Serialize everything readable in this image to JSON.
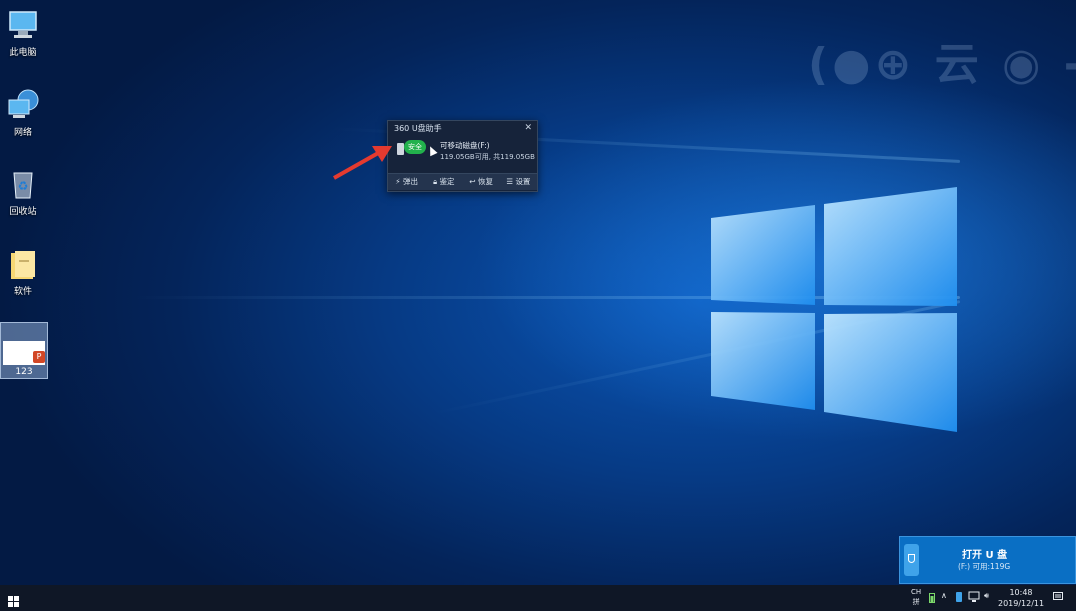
{
  "desktop": {
    "icons": [
      {
        "label": "此电脑",
        "icon": "computer-icon"
      },
      {
        "label": "网络",
        "icon": "network-icon"
      },
      {
        "label": "回收站",
        "icon": "recycle-bin-icon"
      },
      {
        "label": "软件",
        "icon": "folder-icon"
      },
      {
        "label": "123",
        "icon": "powerpoint-file-icon"
      }
    ],
    "watermark": "(●⊕ 云 ◉ -"
  },
  "u_disk_widget": {
    "title": "360 U盘助手",
    "close_glyph": "✕",
    "safe_badge": "安全",
    "drive_name": "可移动磁盘(F:)",
    "drive_space": "119.05GB可用, 共119.05GB",
    "tools": [
      {
        "label": "弹出",
        "icon": "eject-icon"
      },
      {
        "label": "鉴定",
        "icon": "lock-icon"
      },
      {
        "label": "恢复",
        "icon": "restore-icon"
      },
      {
        "label": "设置",
        "icon": "settings-list-icon"
      }
    ]
  },
  "usb_popup": {
    "title": "打开 U 盘",
    "subtitle": "(F:)  可用:119G",
    "icon": "usb-drive-icon"
  },
  "taskbar": {
    "start_icon": "windows-start-icon",
    "ime_top": "CH",
    "ime_bottom": "拼",
    "tray_icons": [
      "battery-icon",
      "chevron-up-icon",
      "usb-tray-icon",
      "network-tray-icon",
      "volume-icon"
    ],
    "time": "10:48",
    "date": "2019/12/11",
    "notification_icon": "notification-icon"
  },
  "colors": {
    "accent_blue": "#0a6fc4",
    "safe_green": "#22b14c",
    "arrow_red": "#e43a2f",
    "taskbar": "#0f1726"
  }
}
